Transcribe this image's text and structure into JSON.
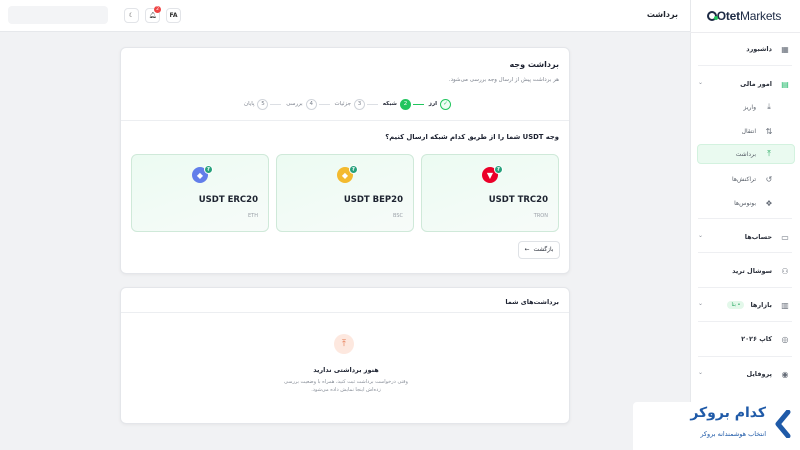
{
  "header": {
    "title": "برداشت",
    "lang": "FA",
    "notifications_count": "2"
  },
  "logo": {
    "bold": "Otet",
    "light": "Markets"
  },
  "sidebar": {
    "dashboard": "داشبورد",
    "financial": "امور مالی",
    "deposit": "واریز",
    "transfer": "انتقال",
    "withdraw": "برداشت",
    "transactions": "تراکنش‌ها",
    "bonuses": "بونوس‌ها",
    "accounts": "حساب‌ها",
    "social_trade": "سوشال ترید",
    "markets": "بازارها",
    "markets_badge": "• بتا",
    "cup": "کاپ ۲۰۲۶",
    "profile": "پروفایل"
  },
  "withdraw_card": {
    "title": "برداشت وجه",
    "description": "هر برداشت پیش از ارسال وجه بررسی می‌شود.",
    "steps": [
      {
        "num": "✓",
        "label": "ارز"
      },
      {
        "num": "2",
        "label": "شبکه"
      },
      {
        "num": "3",
        "label": "جزئیات"
      },
      {
        "num": "4",
        "label": "بررسی"
      },
      {
        "num": "5",
        "label": "پایان"
      }
    ],
    "question_prefix": "وجه",
    "question_currency": "USDT",
    "question_suffix": "شما را از طریق کدام شبکه ارسال کنیم؟",
    "networks": [
      {
        "name": "USDT TRC20",
        "sub": "TRON",
        "color": "#eb0029"
      },
      {
        "name": "USDT BEP20",
        "sub": "BSC",
        "color": "#f3ba2f"
      },
      {
        "name": "USDT ERC20",
        "sub": "ETH",
        "color": "#627eea"
      }
    ],
    "back_label": "بازگشت"
  },
  "withdrawals_card": {
    "title": "برداشت‌های شما",
    "empty_title": "هنوز برداشتی ندارید",
    "empty_desc": "وقتی درخواست برداشت ثبت کنید، همراه با وضعیت بررسی زده‌اش اینجا نمایش داده می‌شود."
  },
  "watermark": {
    "title": "کدام بروکر",
    "subtitle": "انتخاب هوشمندانه بروکر"
  }
}
